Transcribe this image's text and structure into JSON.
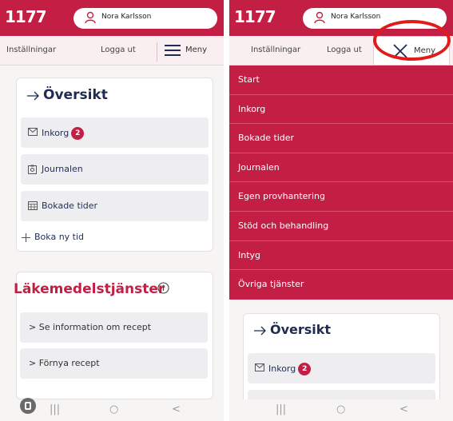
{
  "header": {
    "logo": "1177",
    "user_name": "Nora Karlsson"
  },
  "nav": {
    "settings": "Inställningar",
    "logout": "Logga ut",
    "menu": "Meny"
  },
  "overview": {
    "title": "Översikt",
    "items": [
      {
        "label": "Inkorg",
        "badge": "2"
      },
      {
        "label": "Journalen"
      },
      {
        "label": "Bokade tider"
      }
    ],
    "book_new": "Boka ny tid"
  },
  "medicine": {
    "title": "Läkemedelstjänster",
    "items": [
      {
        "label": "Se information om recept"
      },
      {
        "label": "Förnya recept"
      }
    ]
  },
  "menu_items": [
    "Start",
    "Inkorg",
    "Bokade tider",
    "Journalen",
    "Egen provhantering",
    "Stöd och behandling",
    "Intyg",
    "Övriga tjänster"
  ],
  "colors": {
    "brand": "#c31f45",
    "annotation": "#e11a1a"
  },
  "icons": [
    "person-icon",
    "hamburger-icon",
    "close-icon",
    "arrow-right-icon",
    "mail-icon",
    "journal-icon",
    "calendar-icon",
    "plus-icon",
    "info-icon",
    "chevron-right-icon"
  ]
}
